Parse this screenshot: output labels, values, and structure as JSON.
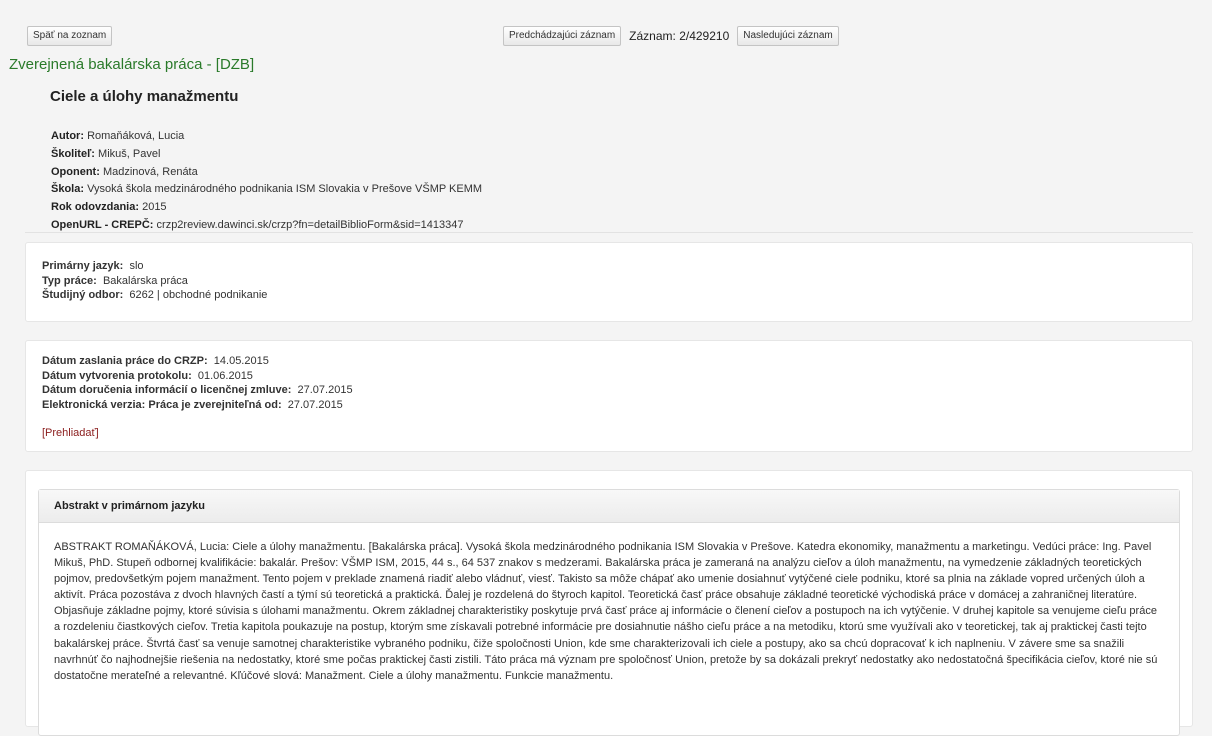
{
  "nav": {
    "back_label": "Späť na zoznam",
    "prev_label": "Predchádzajúci záznam",
    "record_counter": "Záznam: 2/429210",
    "next_label": "Nasledujúci záznam"
  },
  "doc_type": "Zverejnená bakalárska práca - [DZB]",
  "title": "Ciele a úlohy manažmentu",
  "meta": [
    {
      "label": "Autor:",
      "value": "Romaňáková, Lucia"
    },
    {
      "label": "Školiteľ:",
      "value": "Mikuš, Pavel"
    },
    {
      "label": "Oponent:",
      "value": "Madzinová, Renáta"
    },
    {
      "label": "Škola:",
      "value": "Vysoká škola medzinárodného podnikania ISM Slovakia v Prešove VŠMP KEMM"
    },
    {
      "label": "Rok odovzdania:",
      "value": "2015"
    },
    {
      "label": "OpenURL - CREPČ:",
      "value": "crzp2review.dawinci.sk/crzp?fn=detailBiblioForm&sid=1413347"
    }
  ],
  "basic_info": [
    {
      "label": "Primárny jazyk:",
      "value": "slo"
    },
    {
      "label": "Typ práce:",
      "value": "Bakalárska práca"
    },
    {
      "label": "Študijný odbor:",
      "value": "6262 | obchodné podnikanie"
    }
  ],
  "dates": [
    {
      "label": "Dátum zaslania práce do CRZP:",
      "value": "14.05.2015"
    },
    {
      "label": "Dátum vytvorenia protokolu:",
      "value": "01.06.2015"
    },
    {
      "label": "Dátum doručenia informácií o licenčnej zmluve:",
      "value": "27.07.2015"
    },
    {
      "label": "Elektronická verzia: Práca je zverejniteľná od:",
      "value": "27.07.2015"
    }
  ],
  "preview_link": "[Prehliadať]",
  "abstract": {
    "heading": "Abstrakt v primárnom jazyku",
    "text": "ABSTRAKT ROMAŇÁKOVÁ, Lucia: Ciele a úlohy manažmentu. [Bakalárska práca]. Vysoká škola medzinárodného podnikania ISM Slovakia v Prešove. Katedra ekonomiky, manažmentu a marketingu. Vedúci práce: Ing. Pavel Mikuš, PhD. Stupeň odbornej kvalifikácie: bakalár. Prešov: VŠMP ISM, 2015, 44 s., 64 537 znakov s medzerami. Bakalárska práca je zameraná na analýzu cieľov a úloh manažmentu, na vymedzenie základných teoretických pojmov, predovšetkým pojem manažment. Tento pojem v preklade znamená riadiť alebo vládnuť, viesť. Takisto sa môže chápať ako umenie dosiahnuť vytýčené ciele podniku, ktoré sa plnia na základe vopred určených úloh a aktivít. Práca pozostáva z dvoch hlavných častí a týmí sú teoretická a praktická. Ďalej je rozdelená do štyroch kapitol. Teoretická časť práce obsahuje základné teoretické východiská práce v domácej a zahraničnej literatúre. Objasňuje základne pojmy, ktoré súvisia s úlohami manažmentu. Okrem základnej charakteristiky poskytuje prvá časť práce aj informácie o členení cieľov a postupoch na ich vytýčenie. V druhej kapitole sa venujeme cieľu práce a rozdeleniu čiastkových cieľov. Tretia kapitola poukazuje na postup, ktorým sme získavali potrebné informácie pre dosiahnutie nášho cieľu práce a na metodiku, ktorú sme využívali ako v teoretickej, tak aj praktickej časti tejto bakalárskej práce. Štvrtá časť sa venuje samotnej charakteristike vybraného podniku, čiže spoločnosti Union, kde sme charakterizovali ich ciele a postupy, ako sa chcú dopracovať k ich naplneniu. V závere sme sa snažili navrhnúť čo najhodnejšie riešenia na nedostatky, ktoré sme počas praktickej časti zistili. Táto práca má význam pre spoločnosť Union, pretože by sa dokázali prekryť nedostatky ako nedostatočná špecifikácia cieľov, ktoré nie sú dostatočne merateľné a relevantné. Kľúčové slová: Manažment. Ciele a úlohy manažmentu. Funkcie manažmentu."
  }
}
